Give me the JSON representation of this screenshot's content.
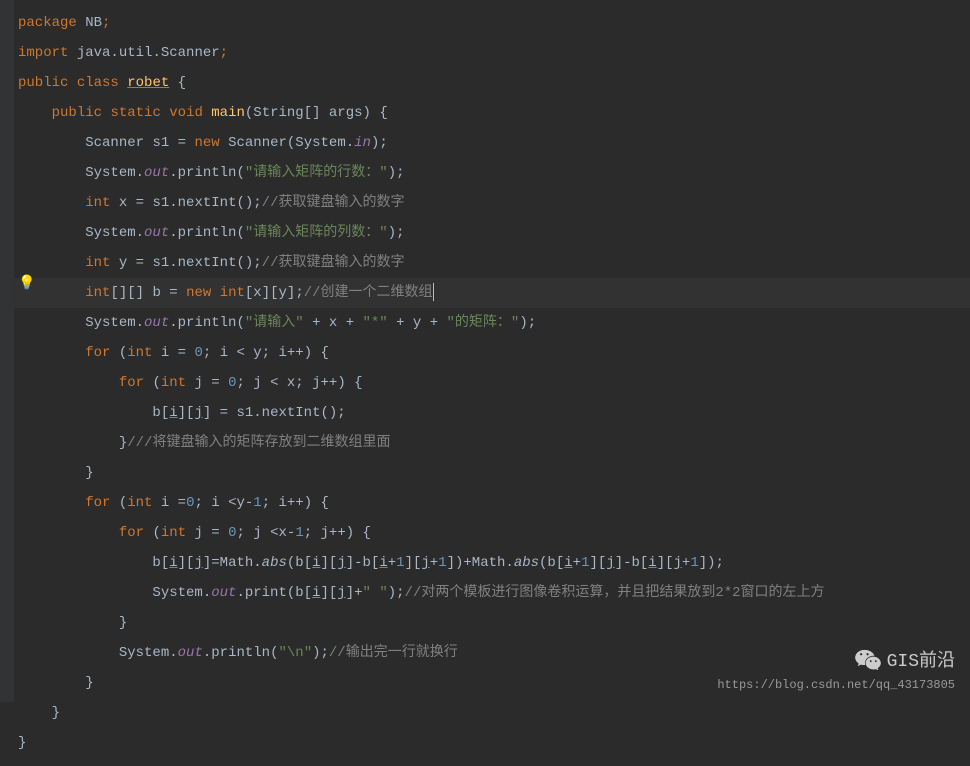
{
  "code": {
    "l1": {
      "kw_package": "package",
      "pkg": "NB",
      "semi": ";"
    },
    "l2": {
      "kw_import": "import",
      "ns": "java.util.Scanner",
      "semi": ";"
    },
    "l3": {
      "kw_public": "public",
      "kw_class": "class",
      "name": "robet",
      "brace": "{"
    },
    "l4": {
      "kw_public": "public",
      "kw_static": "static",
      "kw_void": "void",
      "fn": "main",
      "args": "(String[] args) {"
    },
    "l5": {
      "type": "Scanner",
      "var": "s1",
      "eq": " = ",
      "kw_new": "new",
      "ctor": "Scanner",
      "open": "(System.",
      "in": "in",
      "close": ");"
    },
    "l6": {
      "sys": "System.",
      "out": "out",
      "dot": ".println(",
      "str": "\"请输入矩阵的行数：\"",
      "end": ");"
    },
    "l7": {
      "kw_int": "int",
      "var": "x",
      "eq": " = s1.nextInt();",
      "comment": "//获取键盘输入的数字"
    },
    "l8": {
      "sys": "System.",
      "out": "out",
      "dot": ".println(",
      "str": "\"请输入矩阵的列数：\"",
      "end": ");"
    },
    "l9": {
      "kw_int": "int",
      "var": "y",
      "eq": " = s1.nextInt();",
      "comment": "//获取键盘输入的数字"
    },
    "l10": {
      "kw_int": "int",
      "arr": "[][] ",
      "var": "b",
      "eq": " = ",
      "kw_new": "new",
      "kw_int2": " int",
      "dims": "[x][y];",
      "comment": "//创建一个二维数组"
    },
    "l11": {
      "sys": "System.",
      "out": "out",
      "dot": ".println(",
      "str1": "\"请输入\"",
      "plus1": " + x + ",
      "str2": "\"*\"",
      "plus2": " + y + ",
      "str3": "\"的矩阵：\"",
      "end": ");"
    },
    "l12": {
      "kw_for": "for",
      "open": " (",
      "kw_int": "int",
      "init": " i = ",
      "zero": "0",
      "cond": "; i < y; i++) {"
    },
    "l13": {
      "kw_for": "for",
      "open": " (",
      "kw_int": "int",
      "init": " j = ",
      "zero": "0",
      "cond": "; j < x; j++) {"
    },
    "l14": {
      "text": "b[i][j] = s1.nextInt();"
    },
    "l15": {
      "brace": "}",
      "comment": "///将键盘输入的矩阵存放到二维数组里面"
    },
    "l16": {
      "brace": "}"
    },
    "l17": {
      "kw_for": "for",
      "open": " (",
      "kw_int": "int",
      "init": " i =",
      "zero": "0",
      "cond": "; i <y-",
      "one": "1",
      "cond2": "; i++) {"
    },
    "l18": {
      "kw_for": "for",
      "open": " (",
      "kw_int": "int",
      "init": " j = ",
      "zero": "0",
      "cond": "; j <x-",
      "one": "1",
      "cond2": "; j++) {"
    },
    "l19": {
      "pre": "b[i][j]=Math.",
      "abs1": "abs",
      "mid1": "(b[i][j]-b[i+",
      "n1": "1",
      "mid2": "][j+",
      "n2": "1",
      "mid3": "])+Math.",
      "abs2": "abs",
      "mid4": "(b[i+",
      "n3": "1",
      "mid5": "][j]-b[i][j+",
      "n4": "1",
      "end": "]);"
    },
    "l20": {
      "sys": "System.",
      "out": "out",
      "dot": ".print(b[i][j]+",
      "str": "\" \"",
      "end": ");",
      "comment": "//对两个模板进行图像卷积运算，并且把结果放到2*2窗口的左上方"
    },
    "l21": {
      "brace": "}"
    },
    "l22": {
      "sys": "System.",
      "out": "out",
      "dot": ".println(",
      "str": "\"\\n\"",
      "end": ");",
      "comment": "//输出完一行就换行"
    },
    "l23": {
      "brace": "}"
    },
    "l24": {
      "brace": "}"
    },
    "l25": {
      "brace": "}"
    }
  },
  "watermark": {
    "text": "GIS前沿",
    "url": "https://blog.csdn.net/qq_43173805"
  }
}
